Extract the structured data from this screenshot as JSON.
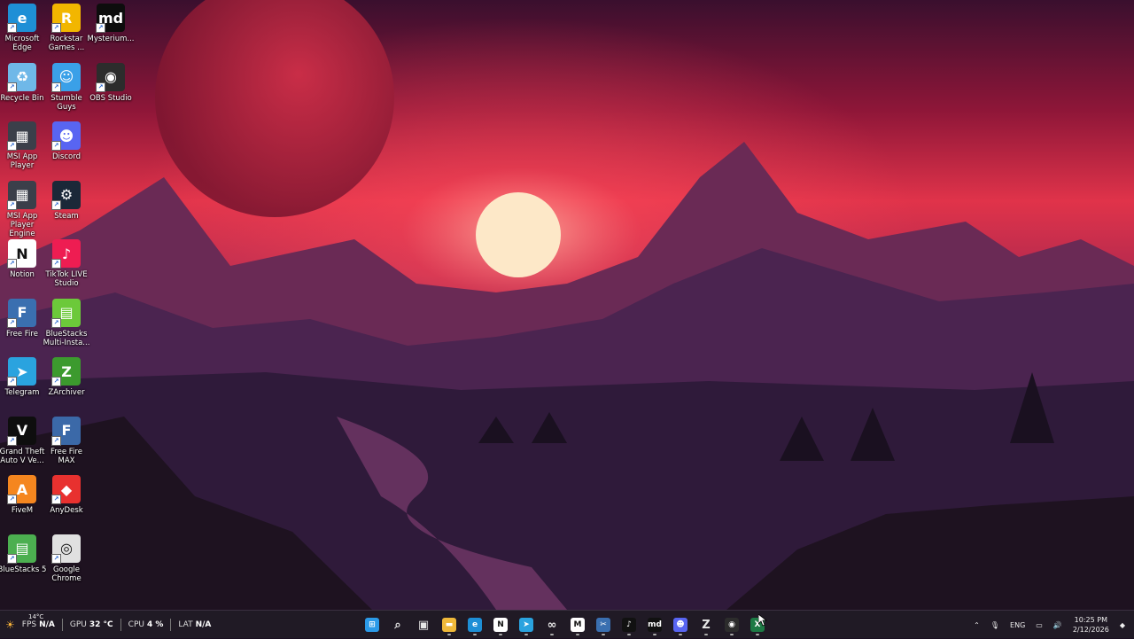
{
  "desktop": {
    "icons": [
      {
        "label": "Microsoft Edge",
        "icon": "edge-icon",
        "color": "#1e8fd6",
        "glyph": "e"
      },
      {
        "label": "Rockstar Games ...",
        "icon": "rockstar-icon",
        "color": "#f2b600",
        "glyph": "R"
      },
      {
        "label": "Mysterium...",
        "icon": "mysterium-icon",
        "color": "#0d0d0d",
        "glyph": "md"
      },
      {
        "label": "Recycle Bin",
        "icon": "recycle-bin-icon",
        "color": "#6fb8e8",
        "glyph": "♻"
      },
      {
        "label": "Stumble Guys",
        "icon": "stumble-guys-icon",
        "color": "#3aa0e8",
        "glyph": "☺"
      },
      {
        "label": "OBS Studio",
        "icon": "obs-icon",
        "color": "#2c2c2c",
        "glyph": "◉"
      },
      {
        "label": "MSI App Player",
        "icon": "msi-app-player-icon",
        "color": "#3b3f4a",
        "glyph": "▦"
      },
      {
        "label": "Discord",
        "icon": "discord-icon",
        "color": "#5865f2",
        "glyph": "☻"
      },
      {
        "label": "MSI App Player Engine",
        "icon": "msi-engine-icon",
        "color": "#3b3f4a",
        "glyph": "▦"
      },
      {
        "label": "Steam",
        "icon": "steam-icon",
        "color": "#1b2838",
        "glyph": "⚙"
      },
      {
        "label": "Notion",
        "icon": "notion-icon",
        "color": "#ffffff",
        "glyph": "N"
      },
      {
        "label": "TikTok LIVE Studio",
        "icon": "tiktok-live-icon",
        "color": "#ee1d52",
        "glyph": "♪"
      },
      {
        "label": "Free Fire",
        "icon": "free-fire-icon",
        "color": "#3a6fb0",
        "glyph": "F"
      },
      {
        "label": "BlueStacks Multi-Insta...",
        "icon": "bluestacks-multi-icon",
        "color": "#6cc93a",
        "glyph": "▤"
      },
      {
        "label": "Telegram",
        "icon": "telegram-icon",
        "color": "#2aa3df",
        "glyph": "➤"
      },
      {
        "label": "ZArchiver",
        "icon": "zarchiver-icon",
        "color": "#3c9a2e",
        "glyph": "Z"
      },
      {
        "label": "Grand Theft Auto V Ve...",
        "icon": "gta-v-icon",
        "color": "#0e0e0e",
        "glyph": "V"
      },
      {
        "label": "Free Fire MAX",
        "icon": "free-fire-max-icon",
        "color": "#3b69a8",
        "glyph": "F"
      },
      {
        "label": "FiveM",
        "icon": "fivem-icon",
        "color": "#f5861f",
        "glyph": "A"
      },
      {
        "label": "AnyDesk",
        "icon": "anydesk-icon",
        "color": "#e8312f",
        "glyph": "◆"
      },
      {
        "label": "BlueStacks 5",
        "icon": "bluestacks5-icon",
        "color": "#4caf50",
        "glyph": "▤"
      },
      {
        "label": "Google Chrome",
        "icon": "chrome-icon",
        "color": "#e0e0e0",
        "glyph": "◎"
      }
    ]
  },
  "overlay": {
    "fps_label": "FPS",
    "fps_value": "N/A",
    "gpu_label": "GPU",
    "gpu_value": "32 °C",
    "cpu_label": "CPU",
    "cpu_value": "4 %",
    "lat_label": "LAT",
    "lat_value": "N/A",
    "weather_temp": "14°C"
  },
  "taskbar": {
    "apps": [
      {
        "name": "start-button",
        "color": "#2b9ae8",
        "glyph": "⊞"
      },
      {
        "name": "search-icon",
        "color": "transparent",
        "glyph": "⌕"
      },
      {
        "name": "task-view-icon",
        "color": "transparent",
        "glyph": "▣"
      },
      {
        "name": "file-explorer-icon",
        "color": "#f0b93a",
        "glyph": "▬"
      },
      {
        "name": "edge-icon",
        "color": "#1e8fd6",
        "glyph": "e"
      },
      {
        "name": "notion-icon",
        "color": "#ffffff",
        "glyph": "N"
      },
      {
        "name": "telegram-icon",
        "color": "#2aa3df",
        "glyph": "➤"
      },
      {
        "name": "meta-icon",
        "color": "transparent",
        "glyph": "∞"
      },
      {
        "name": "capcut-icon",
        "color": "#ffffff",
        "glyph": "M"
      },
      {
        "name": "sniping-tool-icon",
        "color": "#3a6fb0",
        "glyph": "✂"
      },
      {
        "name": "tiktok-icon",
        "color": "#111111",
        "glyph": "♪"
      },
      {
        "name": "mysterium-icon",
        "color": "#111111",
        "glyph": "md"
      },
      {
        "name": "discord-icon",
        "color": "#5865f2",
        "glyph": "☻"
      },
      {
        "name": "zed-icon",
        "color": "transparent",
        "glyph": "Z"
      },
      {
        "name": "obs-icon",
        "color": "#2c2c2c",
        "glyph": "◉"
      },
      {
        "name": "excel-icon",
        "color": "#1d7a45",
        "glyph": "X"
      }
    ]
  },
  "tray": {
    "language": "ENG",
    "time": "10:25 PM",
    "date": "2/12/2026"
  }
}
